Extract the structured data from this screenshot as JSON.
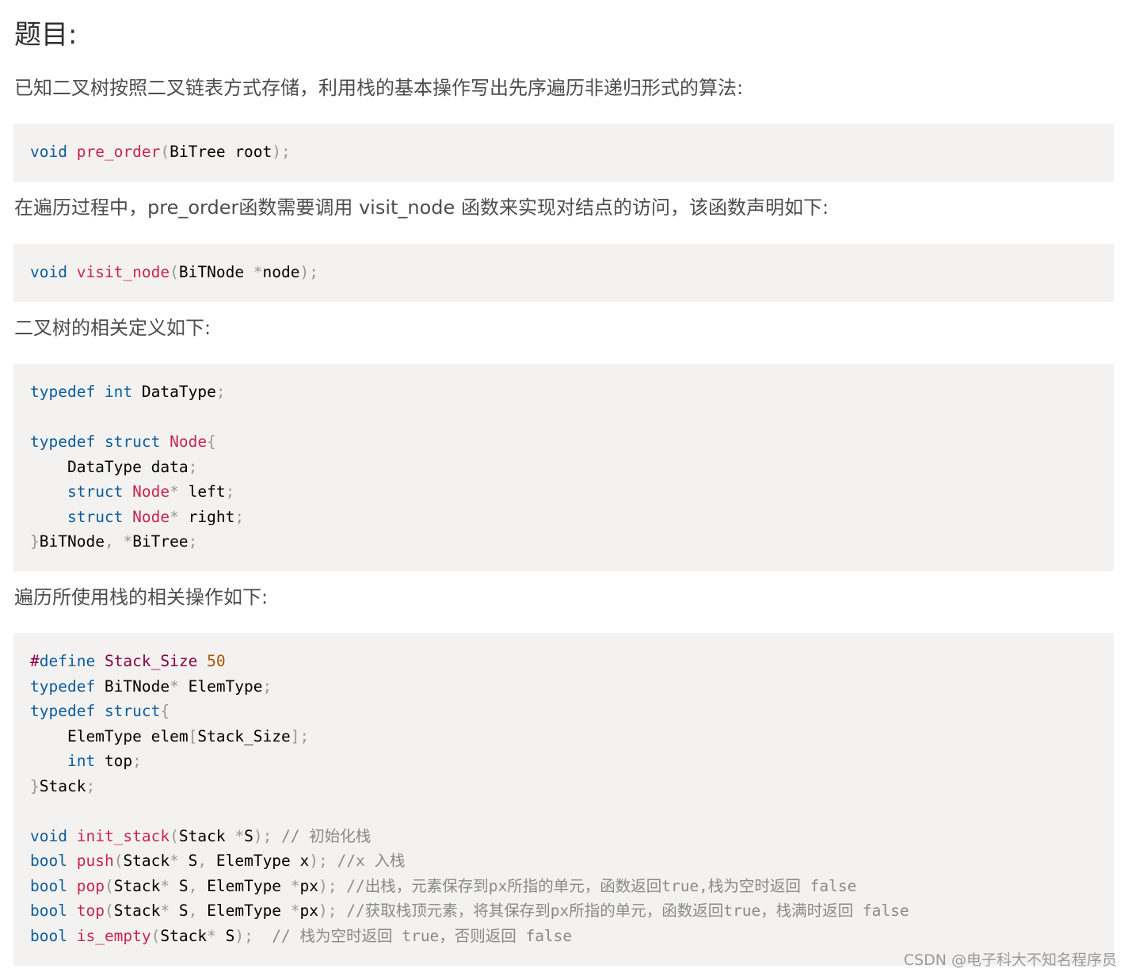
{
  "heading": "题目:",
  "paragraphs": [
    "已知二叉树按照二叉链表方式存储，利用栈的基本操作写出先序遍历非递归形式的算法:",
    "在遍历过程中，pre_order函数需要调用 visit_node 函数来实现对结点的访问，该函数声明如下:",
    "二叉树的相关定义如下:",
    "遍历所使用栈的相关操作如下:"
  ],
  "code_blocks": [
    {
      "lines": [
        [
          [
            "kw",
            "void"
          ],
          [
            "t",
            " "
          ],
          [
            "fn",
            "pre_order"
          ],
          [
            "pun",
            "("
          ],
          [
            "t",
            "BiTree root"
          ],
          [
            "pun",
            ");"
          ]
        ]
      ]
    },
    {
      "lines": [
        [
          [
            "kw",
            "void"
          ],
          [
            "t",
            " "
          ],
          [
            "fn",
            "visit_node"
          ],
          [
            "pun",
            "("
          ],
          [
            "t",
            "BiTNode "
          ],
          [
            "pun",
            "*"
          ],
          [
            "t",
            "node"
          ],
          [
            "pun",
            ");"
          ]
        ]
      ]
    },
    {
      "lines": [
        [
          [
            "kw",
            "typedef"
          ],
          [
            "t",
            " "
          ],
          [
            "kw",
            "int"
          ],
          [
            "t",
            " DataType"
          ],
          [
            "pun",
            ";"
          ]
        ],
        [],
        [
          [
            "kw",
            "typedef"
          ],
          [
            "t",
            " "
          ],
          [
            "kw",
            "struct"
          ],
          [
            "t",
            " "
          ],
          [
            "fn",
            "Node"
          ],
          [
            "pun",
            "{"
          ]
        ],
        [
          [
            "t",
            "    DataType data"
          ],
          [
            "pun",
            ";"
          ]
        ],
        [
          [
            "t",
            "    "
          ],
          [
            "kw",
            "struct"
          ],
          [
            "t",
            " "
          ],
          [
            "fn",
            "Node"
          ],
          [
            "pun",
            "*"
          ],
          [
            "t",
            " left"
          ],
          [
            "pun",
            ";"
          ]
        ],
        [
          [
            "t",
            "    "
          ],
          [
            "kw",
            "struct"
          ],
          [
            "t",
            " "
          ],
          [
            "fn",
            "Node"
          ],
          [
            "pun",
            "*"
          ],
          [
            "t",
            " right"
          ],
          [
            "pun",
            ";"
          ]
        ],
        [
          [
            "pun",
            "}"
          ],
          [
            "t",
            "BiTNode"
          ],
          [
            "pun",
            ","
          ],
          [
            "t",
            " "
          ],
          [
            "pun",
            "*"
          ],
          [
            "t",
            "BiTree"
          ],
          [
            "pun",
            ";"
          ]
        ]
      ]
    },
    {
      "lines": [
        [
          [
            "pp",
            "#"
          ],
          [
            "kw",
            "define"
          ],
          [
            "t",
            " "
          ],
          [
            "pp",
            "Stack_Size"
          ],
          [
            "t",
            " "
          ],
          [
            "num",
            "50"
          ]
        ],
        [
          [
            "kw",
            "typedef"
          ],
          [
            "t",
            " BiTNode"
          ],
          [
            "pun",
            "*"
          ],
          [
            "t",
            " ElemType"
          ],
          [
            "pun",
            ";"
          ]
        ],
        [
          [
            "kw",
            "typedef"
          ],
          [
            "t",
            " "
          ],
          [
            "kw",
            "struct"
          ],
          [
            "pun",
            "{"
          ]
        ],
        [
          [
            "t",
            "    ElemType elem"
          ],
          [
            "pun",
            "["
          ],
          [
            "t",
            "Stack_Size"
          ],
          [
            "pun",
            "];"
          ]
        ],
        [
          [
            "t",
            "    "
          ],
          [
            "kw",
            "int"
          ],
          [
            "t",
            " top"
          ],
          [
            "pun",
            ";"
          ]
        ],
        [
          [
            "pun",
            "}"
          ],
          [
            "t",
            "Stack"
          ],
          [
            "pun",
            ";"
          ]
        ],
        [],
        [
          [
            "kw",
            "void"
          ],
          [
            "t",
            " "
          ],
          [
            "fn",
            "init_stack"
          ],
          [
            "pun",
            "("
          ],
          [
            "t",
            "Stack "
          ],
          [
            "pun",
            "*"
          ],
          [
            "t",
            "S"
          ],
          [
            "pun",
            ");"
          ],
          [
            "t",
            " "
          ],
          [
            "cm",
            "// 初始化栈"
          ]
        ],
        [
          [
            "kw",
            "bool"
          ],
          [
            "t",
            " "
          ],
          [
            "fn",
            "push"
          ],
          [
            "pun",
            "("
          ],
          [
            "t",
            "Stack"
          ],
          [
            "pun",
            "*"
          ],
          [
            "t",
            " S"
          ],
          [
            "pun",
            ","
          ],
          [
            "t",
            " ElemType x"
          ],
          [
            "pun",
            ");"
          ],
          [
            "t",
            " "
          ],
          [
            "cm",
            "//x 入栈"
          ]
        ],
        [
          [
            "kw",
            "bool"
          ],
          [
            "t",
            " "
          ],
          [
            "fn",
            "pop"
          ],
          [
            "pun",
            "("
          ],
          [
            "t",
            "Stack"
          ],
          [
            "pun",
            "*"
          ],
          [
            "t",
            " S"
          ],
          [
            "pun",
            ","
          ],
          [
            "t",
            " ElemType "
          ],
          [
            "pun",
            "*"
          ],
          [
            "t",
            "px"
          ],
          [
            "pun",
            ");"
          ],
          [
            "t",
            " "
          ],
          [
            "cm",
            "//出栈，元素保存到px所指的单元，函数返回true,栈为空时返回 false"
          ]
        ],
        [
          [
            "kw",
            "bool"
          ],
          [
            "t",
            " "
          ],
          [
            "fn",
            "top"
          ],
          [
            "pun",
            "("
          ],
          [
            "t",
            "Stack"
          ],
          [
            "pun",
            "*"
          ],
          [
            "t",
            " S"
          ],
          [
            "pun",
            ","
          ],
          [
            "t",
            " ElemType "
          ],
          [
            "pun",
            "*"
          ],
          [
            "t",
            "px"
          ],
          [
            "pun",
            ");"
          ],
          [
            "t",
            " "
          ],
          [
            "cm",
            "//获取栈顶元素，将其保存到px所指的单元，函数返回true，栈满时返回 false"
          ]
        ],
        [
          [
            "kw",
            "bool"
          ],
          [
            "t",
            " "
          ],
          [
            "fn",
            "is_empty"
          ],
          [
            "pun",
            "("
          ],
          [
            "t",
            "Stack"
          ],
          [
            "pun",
            "*"
          ],
          [
            "t",
            " S"
          ],
          [
            "pun",
            ");"
          ],
          [
            "t",
            "  "
          ],
          [
            "cm",
            "// 栈为空时返回 true，否则返回 false"
          ]
        ]
      ]
    }
  ],
  "watermark": "CSDN @电子科大不知名程序员"
}
